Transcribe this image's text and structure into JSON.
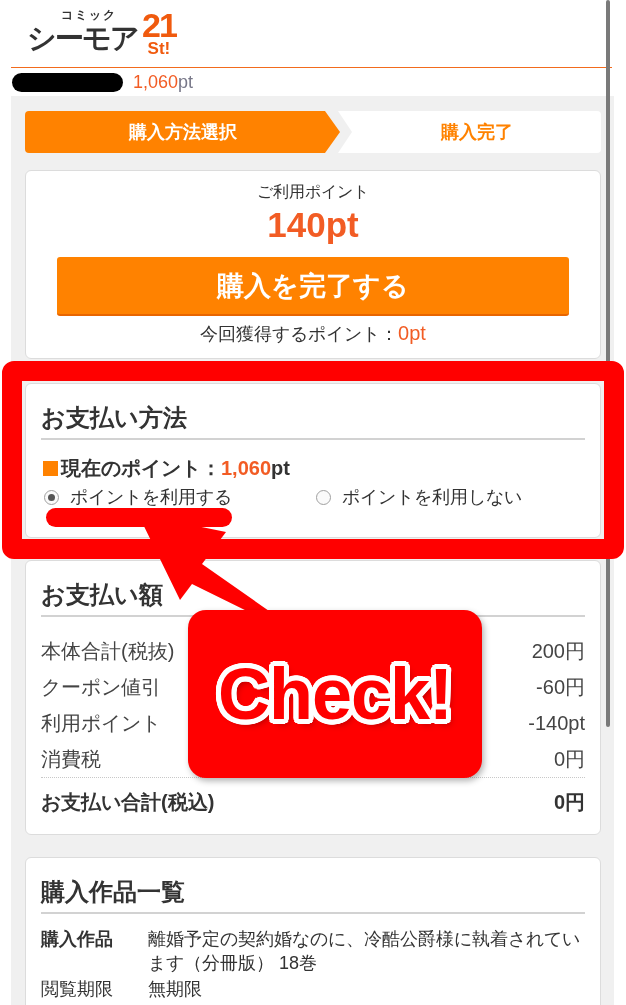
{
  "header": {
    "logo": {
      "top": "コミック",
      "main": "シーモア",
      "number": "21",
      "suffix": "St!"
    },
    "balance": {
      "value": "1,060",
      "unit": "pt"
    }
  },
  "steps": [
    {
      "label": "購入方法選択",
      "selected": true
    },
    {
      "label": "購入完了",
      "selected": false
    }
  ],
  "summary": {
    "label": "ご利用ポイント",
    "points": "140pt",
    "button": "購入を完了する",
    "earned": {
      "label": "今回獲得するポイント：",
      "value": "0pt"
    }
  },
  "payment_method": {
    "title": "お支払い方法",
    "current": {
      "label": "現在のポイント：",
      "value": "1,060",
      "unit": "pt"
    },
    "options": [
      {
        "label": "ポイントを利用する",
        "selected": true
      },
      {
        "label": "ポイントを利用しない",
        "selected": false
      }
    ]
  },
  "payment_amount": {
    "title": "お支払い額",
    "rows": [
      {
        "label": "本体合計(税抜)",
        "value": "200円"
      },
      {
        "label": "クーポン値引",
        "value": "-60円"
      },
      {
        "label": "利用ポイント",
        "value": "-140pt"
      },
      {
        "label": "消費税",
        "value": "0円"
      }
    ],
    "total": {
      "label": "お支払い合計(税込)",
      "value": "0円"
    }
  },
  "purchase_list": {
    "title": "購入作品一覧",
    "rows": [
      {
        "label": "購入作品",
        "value": "離婚予定の契約婚なのに、冷酷公爵様に執着されています（分冊版） 18巻",
        "bold": true
      },
      {
        "label": "閲覧期限",
        "value": "無期限",
        "bold": false
      }
    ]
  },
  "annotation": {
    "label": "Check!"
  }
}
